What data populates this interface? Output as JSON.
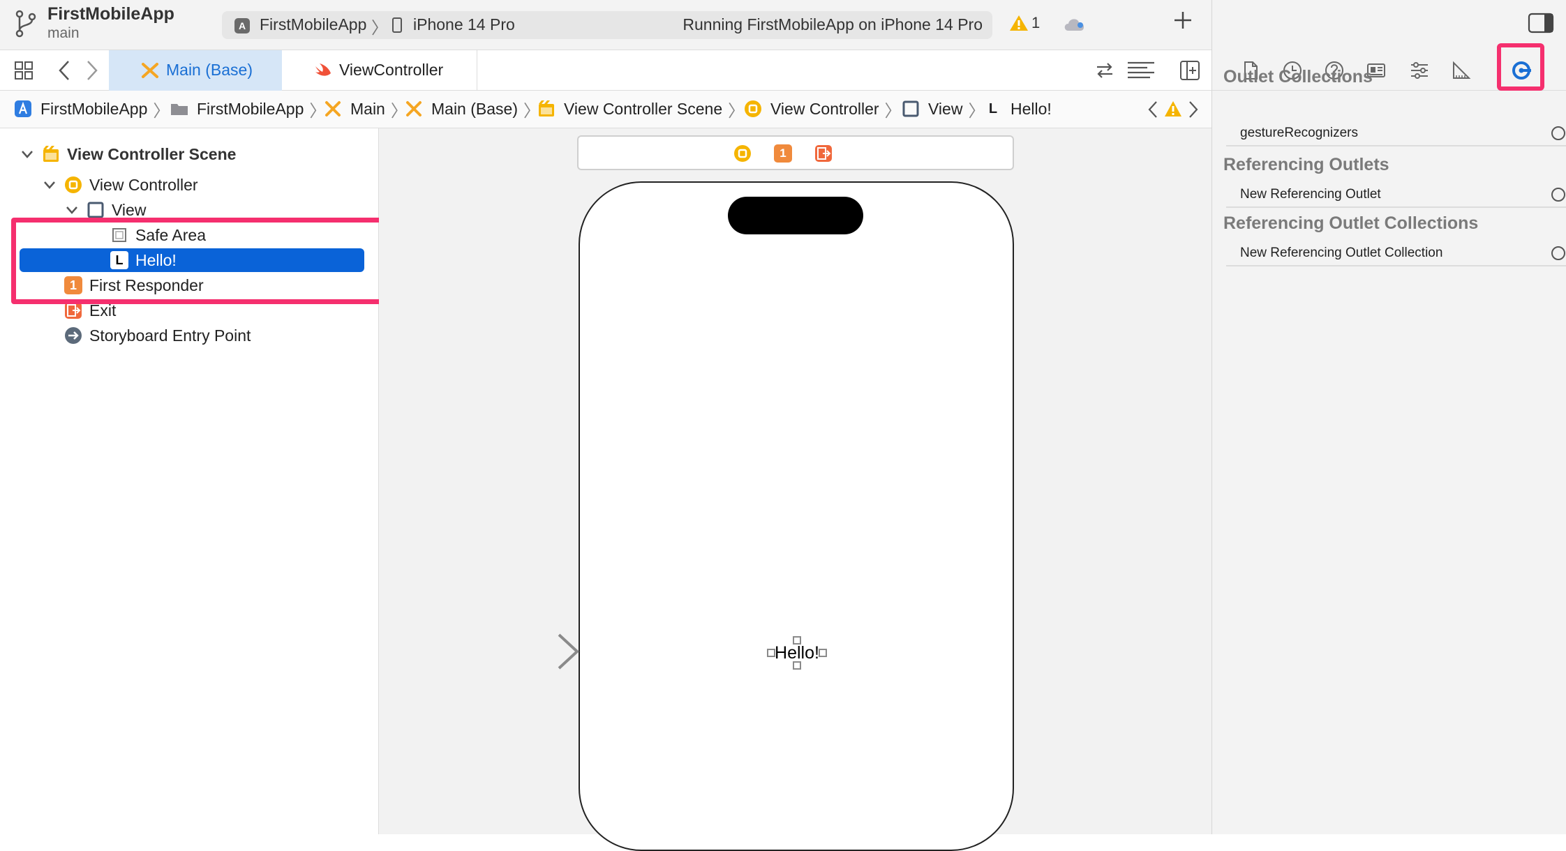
{
  "toolbar": {
    "project_name": "FirstMobileApp",
    "branch": "main",
    "scheme_app": "FirstMobileApp",
    "scheme_device": "iPhone 14 Pro",
    "status": "Running FirstMobileApp on iPhone 14 Pro",
    "warning_count": "1"
  },
  "tabs": [
    {
      "label": "Main (Base)",
      "icon": "storyboard-icon",
      "active": true
    },
    {
      "label": "ViewController",
      "icon": "swift-icon",
      "active": false
    }
  ],
  "breadcrumb": [
    "FirstMobileApp",
    "FirstMobileApp",
    "Main",
    "Main (Base)",
    "View Controller Scene",
    "View Controller",
    "View",
    "Hello!"
  ],
  "outline": {
    "scene": "View Controller Scene",
    "view_controller": "View Controller",
    "view": "View",
    "safe_area": "Safe Area",
    "label": "Hello!",
    "first_responder": "First Responder",
    "exit": "Exit",
    "entry_point": "Storyboard Entry Point",
    "label_badge": "L",
    "responder_badge": "1"
  },
  "canvas": {
    "label_text": "Hello!",
    "dock_responder_badge": "1"
  },
  "inspector": {
    "sections": [
      {
        "title": "Outlet Collections",
        "rows": [
          "gestureRecognizers"
        ]
      },
      {
        "title": "Referencing Outlets",
        "rows": [
          "New Referencing Outlet"
        ]
      },
      {
        "title": "Referencing Outlet Collections",
        "rows": [
          "New Referencing Outlet Collection"
        ]
      }
    ],
    "selected_tab": "connections-inspector-icon"
  },
  "colors": {
    "selection": "#0a63d8",
    "highlight": "#f52f6e",
    "accent": "#1a6fd4",
    "warning": "#f5b400"
  }
}
